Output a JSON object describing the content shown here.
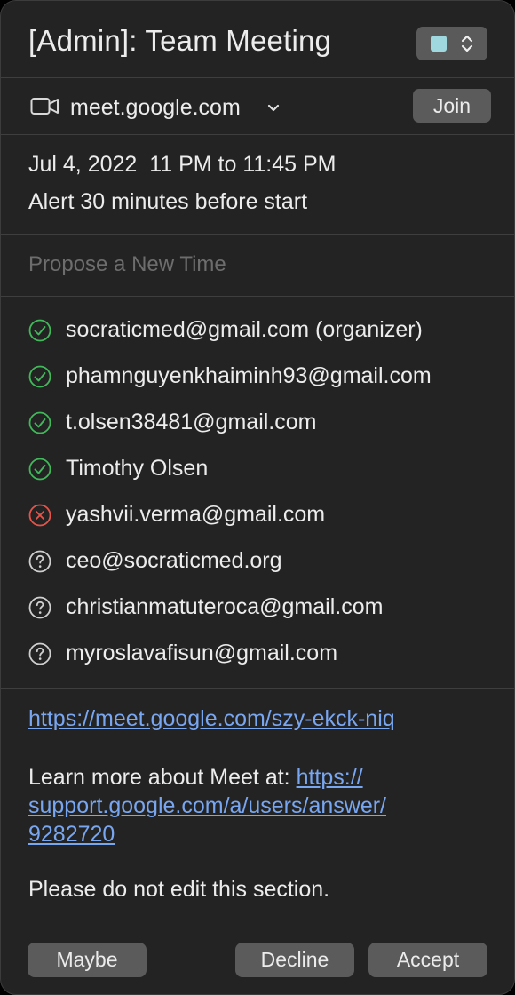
{
  "header": {
    "title": "[Admin]: Team Meeting",
    "calendar_color": "#9fd9df"
  },
  "conference": {
    "icon": "video-camera-icon",
    "host": "meet.google.com",
    "join_label": "Join"
  },
  "schedule": {
    "date_time": "Jul 4, 2022  11 PM to 11:45 PM",
    "alert": "Alert 30 minutes before start"
  },
  "propose": {
    "placeholder": "Propose a New Time"
  },
  "colors": {
    "accepted": "#41b85a",
    "declined": "#e5544b",
    "pending": "#cfcfcf",
    "link": "#79a6f0"
  },
  "attendees": [
    {
      "label": "socraticmed@gmail.com (organizer)",
      "status": "accepted"
    },
    {
      "label": "phamnguyenkhaiminh93@gmail.com",
      "status": "accepted"
    },
    {
      "label": "t.olsen38481@gmail.com",
      "status": "accepted"
    },
    {
      "label": "Timothy Olsen",
      "status": "accepted"
    },
    {
      "label": "yashvii.verma@gmail.com",
      "status": "declined"
    },
    {
      "label": "ceo@socraticmed.org",
      "status": "pending"
    },
    {
      "label": "christianmatuteroca@gmail.com",
      "status": "pending"
    },
    {
      "label": "myroslavafisun@gmail.com",
      "status": "pending"
    }
  ],
  "notes": {
    "meet_url": "https://meet.google.com/szy-ekck-niq",
    "learn_prefix": "Learn more about Meet at: ",
    "learn_url": "https://support.google.com/a/users/answer/9282720",
    "notice": "Please do not edit this section."
  },
  "actions": {
    "maybe": "Maybe",
    "decline": "Decline",
    "accept": "Accept"
  }
}
